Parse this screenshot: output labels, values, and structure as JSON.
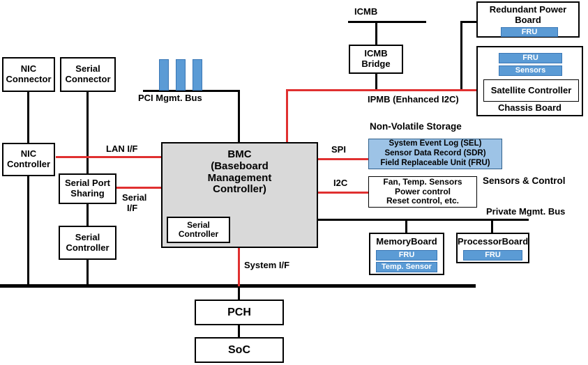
{
  "diagram": {
    "title": "IPMI / BMC platform block diagram",
    "colors": {
      "accent_blue": "#5b9bd5",
      "panel_blue": "#9dc3e6",
      "bus_red": "#e03030",
      "bmc_gray": "#d9d9d9",
      "line_black": "#000000"
    },
    "blocks": {
      "nic_connector": "NIC\nConnector",
      "nic_connector_l1": "NIC",
      "nic_connector_l2": "Connector",
      "serial_connector_l1": "Serial",
      "serial_connector_l2": "Connector",
      "nic_controller_l1": "NIC",
      "nic_controller_l2": "Controller",
      "serial_port_sharing_l1": "Serial Port",
      "serial_port_sharing_l2": "Sharing",
      "serial_controller_left_l1": "Serial",
      "serial_controller_left_l2": "Controller",
      "bmc_l1": "BMC",
      "bmc_l2": "(Baseboard",
      "bmc_l3": "Management",
      "bmc_l4": "Controller)",
      "bmc_serial_controller_l1": "Serial",
      "bmc_serial_controller_l2": "Controller",
      "icmb_bridge_l1": "ICMB",
      "icmb_bridge_l2": "Bridge",
      "redundant_power_board_l1": "Redundant Power",
      "redundant_power_board_l2": "Board",
      "satellite_controller": "Satellite Controller",
      "memory_board": "MemoryBoard",
      "processor_board": "ProcessorBoard",
      "pch": "PCH",
      "soc": "SoC",
      "nvs_l1": "System Event  Log  (SEL)",
      "nvs_l2": "Sensor Data Record (SDR)",
      "nvs_l3": "Field  Replaceable Unit (FRU)",
      "sensors_box_l1": "Fan, Temp. Sensors",
      "sensors_box_l2": "Power control",
      "sensors_box_l3": "Reset control,  etc."
    },
    "badges": {
      "fru": "FRU",
      "sensors": "Sensors",
      "temp_sensor": "Temp. Sensor"
    },
    "labels": {
      "icmb": "ICMB",
      "pci_mgmt_bus": "PCI  Mgmt.  Bus",
      "ipmb": "IPMB (Enhanced  I2C)",
      "chassis_board": "Chassis  Board",
      "non_volatile_storage": "Non-Volatile Storage",
      "lan_if": "LAN  I/F",
      "serial_if_l1": "Serial",
      "serial_if_l2": "I/F",
      "spi": "SPI",
      "i2c": "I2C",
      "sensors_and_control": "Sensors & Control",
      "private_mgmt_bus": "Private  Mgmt.  Bus",
      "system_if": "System  I/F"
    }
  }
}
